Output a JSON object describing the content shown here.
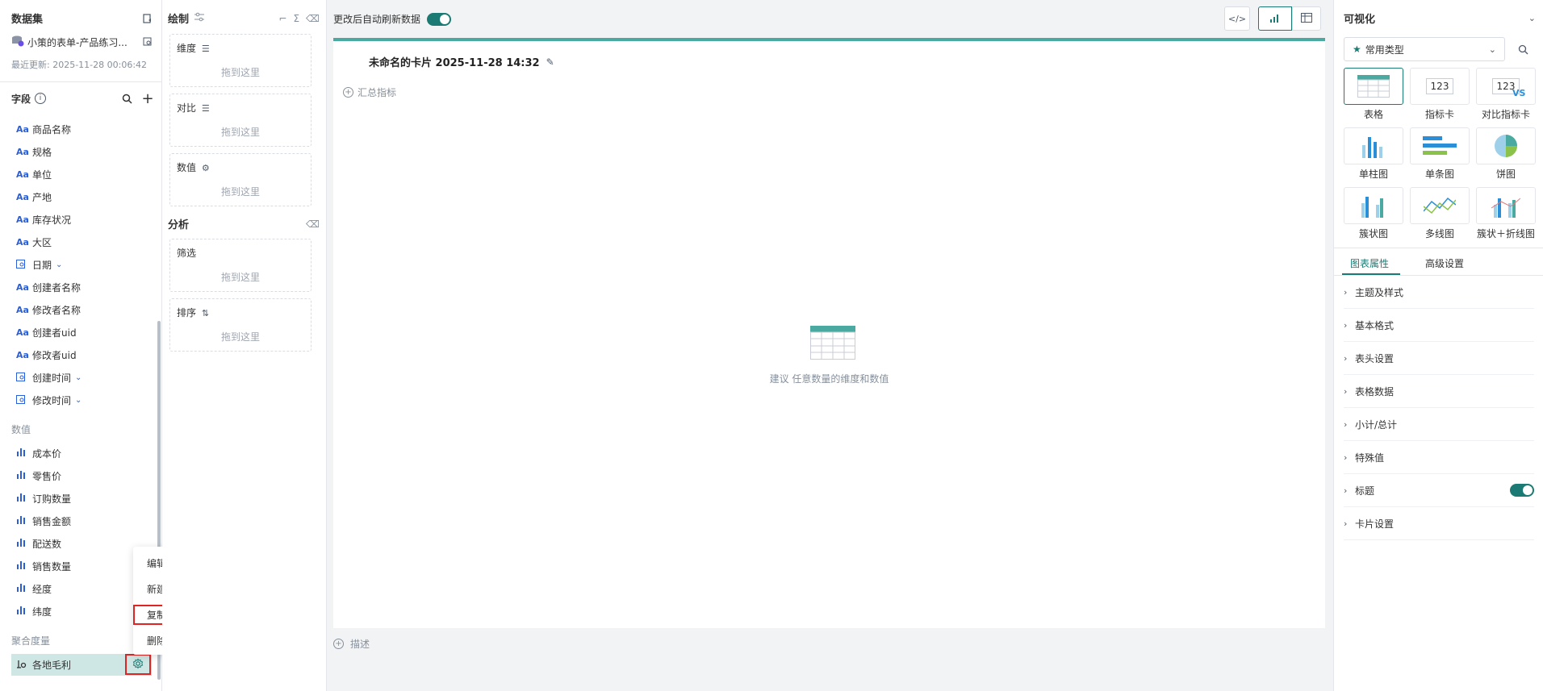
{
  "left": {
    "dataset_title": "数据集",
    "dataset_name": "小策的表单-产品练习...",
    "last_update": "最近更新: 2025-11-28 00:06:42",
    "fields_title": "字段",
    "dim_fields": [
      {
        "label": "商品名称",
        "kind": "text"
      },
      {
        "label": "规格",
        "kind": "text"
      },
      {
        "label": "单位",
        "kind": "text"
      },
      {
        "label": "产地",
        "kind": "text"
      },
      {
        "label": "库存状况",
        "kind": "text"
      },
      {
        "label": "大区",
        "kind": "text"
      },
      {
        "label": "日期",
        "kind": "date"
      },
      {
        "label": "创建者名称",
        "kind": "text"
      },
      {
        "label": "修改者名称",
        "kind": "text"
      },
      {
        "label": "创建者uid",
        "kind": "text"
      },
      {
        "label": "修改者uid",
        "kind": "text"
      },
      {
        "label": "创建时间",
        "kind": "date"
      },
      {
        "label": "修改时间",
        "kind": "date"
      }
    ],
    "measure_title": "数值",
    "measure_fields": [
      "成本价",
      "零售价",
      "订购数量",
      "销售金额",
      "配送数",
      "销售数量",
      "经度",
      "纬度"
    ],
    "agg_title": "聚合度量",
    "agg_field": "各地毛利",
    "text_icon": "Aa"
  },
  "draw": {
    "title": "绘制",
    "dimension": "维度",
    "compare": "对比",
    "value": "数值",
    "drop_hint": "拖到这里",
    "analysis_title": "分析",
    "filter": "筛选",
    "sort": "排序"
  },
  "main": {
    "auto_refresh": "更改后自动刷新数据",
    "card_title": "未命名的卡片 2025-11-28 14:32",
    "summary": "汇总指标",
    "suggest": "建议 任意数量的维度和数值",
    "describe": "描述"
  },
  "right": {
    "title": "可视化",
    "type_select": "常用类型",
    "charts": [
      "表格",
      "指标卡",
      "对比指标卡",
      "单柱图",
      "单条图",
      "饼图",
      "簇状图",
      "多线图",
      "簇状＋折线图"
    ],
    "tile_text_123": "123",
    "tile_text_vs": "VS",
    "tabs": [
      "图表属性",
      "高级设置"
    ],
    "props": [
      "主题及样式",
      "基本格式",
      "表头设置",
      "表格数据",
      "小计/总计",
      "特殊值",
      "标题",
      "卡片设置"
    ]
  },
  "menu": {
    "items": [
      "编辑公式",
      "新建分组字段",
      "复制",
      "删除"
    ]
  },
  "colors": {
    "accent": "#1b7a73",
    "highlight": "#e02424",
    "selected_bg": "#cfe7e4"
  }
}
